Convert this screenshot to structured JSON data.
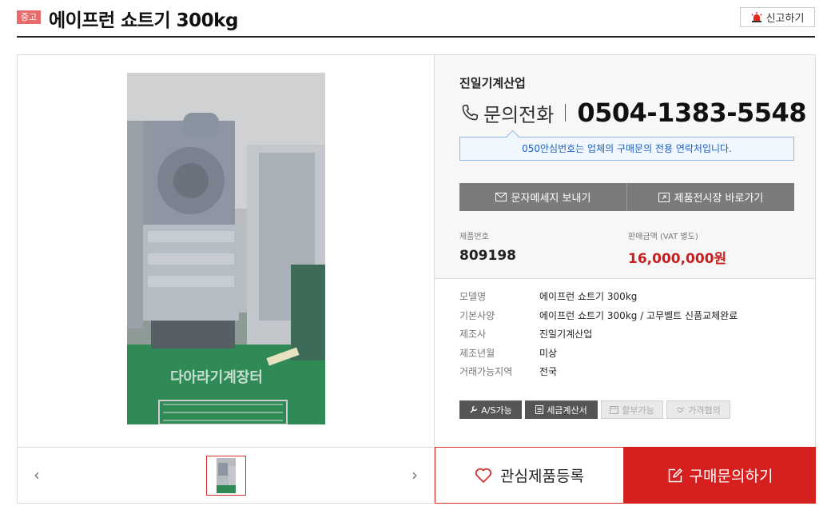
{
  "header": {
    "badge": "중고",
    "title": "에이프런 쇼트기 300kg",
    "report_label": "신고하기"
  },
  "gallery": {
    "watermark": "다아라기계장터",
    "prev_icon": "chevron-left-icon",
    "next_icon": "chevron-right-icon",
    "total_thumbnails": 1
  },
  "seller": {
    "company": "진일기계산업",
    "phone_label": "문의전화",
    "phone_number": "0504-1383-5548",
    "notice": "050안심번호는 업체의 구매문의 전용 연락처입니다."
  },
  "actions": {
    "message_label": "문자메세지 보내기",
    "showroom_label": "제품전시장 바로가기"
  },
  "product": {
    "number_label": "제품번호",
    "number": "809198",
    "price_label": "판매금액 (VAT 별도)",
    "price": "16,000,000원"
  },
  "specs": [
    {
      "key": "모델명",
      "value": "에이프런 쇼트기 300kg"
    },
    {
      "key": "기본사양",
      "value": "에이프런 쇼트기 300kg / 고무벨트 신품교체완료"
    },
    {
      "key": "제조사",
      "value": "진일기계산업"
    },
    {
      "key": "제조년월",
      "value": "미상"
    },
    {
      "key": "거래가능지역",
      "value": "전국"
    }
  ],
  "tags": [
    {
      "label": "A/S가능",
      "icon": "wrench-icon",
      "active": true
    },
    {
      "label": "세금계산서",
      "icon": "receipt-icon",
      "active": true
    },
    {
      "label": "할부가능",
      "icon": "calendar-icon",
      "active": false
    },
    {
      "label": "가격협의",
      "icon": "handshake-icon",
      "active": false
    }
  ],
  "bottom": {
    "wish_label": "관심제품등록",
    "inquire_label": "구매문의하기"
  },
  "colors": {
    "accent_red": "#d61f1f",
    "notice_blue": "#1d5fbf",
    "price_red": "#c81e1e"
  }
}
